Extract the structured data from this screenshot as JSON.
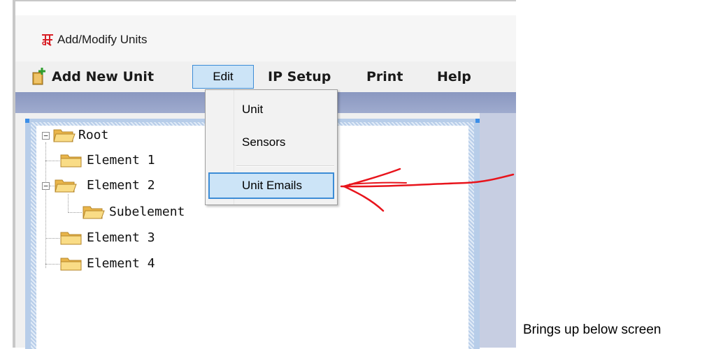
{
  "window": {
    "title": "Add/Modify Units"
  },
  "menubar": {
    "items": [
      {
        "label": "Add New Unit",
        "icon": "add-unit-icon"
      },
      {
        "label": "Edit",
        "active": true
      },
      {
        "label": "IP Setup"
      },
      {
        "label": "Print"
      },
      {
        "label": "Help"
      }
    ]
  },
  "edit_menu": {
    "items": [
      {
        "label": "Unit"
      },
      {
        "label": "Sensors"
      },
      {
        "label": "Unit Emails",
        "highlighted": true
      }
    ]
  },
  "tree": {
    "nodes": [
      {
        "label": "Root",
        "expanded": true
      },
      {
        "label": "Element 1"
      },
      {
        "label": "Element 2",
        "expanded": true
      },
      {
        "label": "Subelement"
      },
      {
        "label": "Element 3"
      },
      {
        "label": "Element 4"
      }
    ]
  },
  "caption": "Brings up below screen",
  "colors": {
    "highlight_fill": "#cce4f7",
    "highlight_border": "#3c8cd6",
    "annotation_arrow": "#e8141c",
    "folder": "#f5cf6a"
  }
}
